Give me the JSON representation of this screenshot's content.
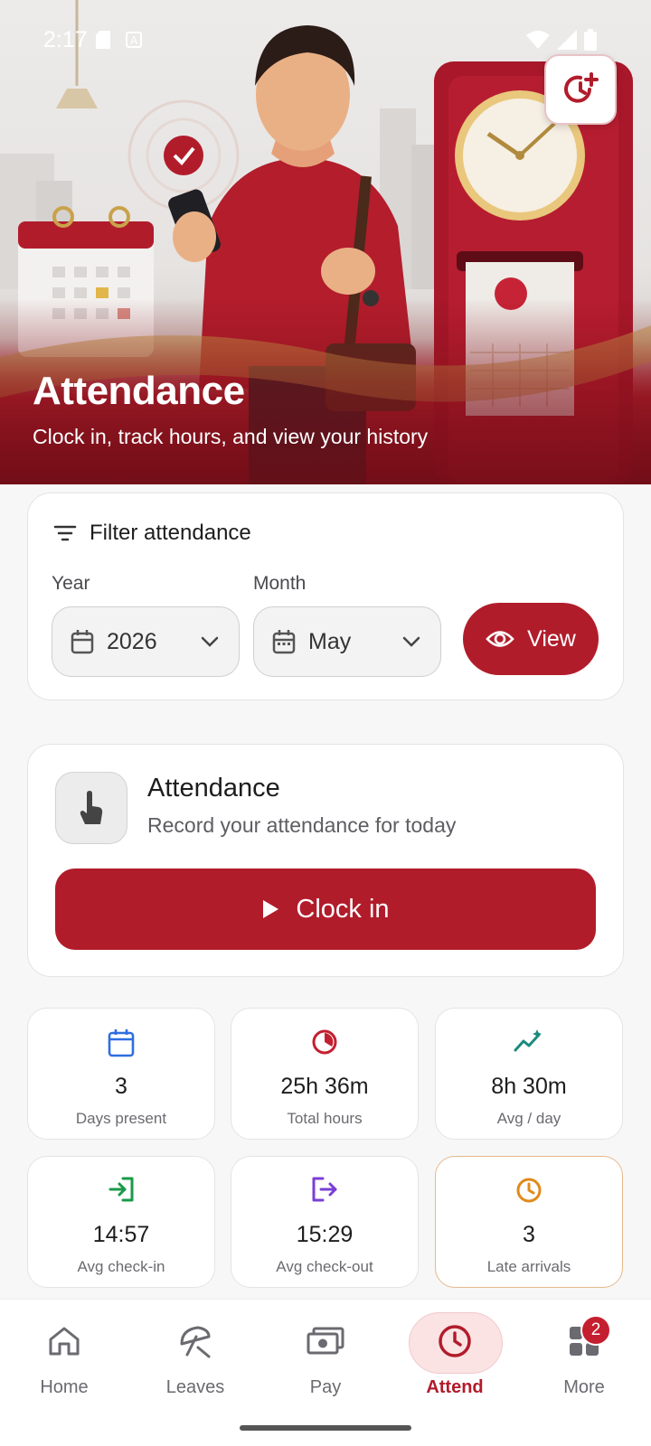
{
  "status_bar": {
    "time": "2:17"
  },
  "hero": {
    "title": "Attendance",
    "subtitle": "Clock in, track hours, and view your history"
  },
  "filter": {
    "title": "Filter attendance",
    "year_label": "Year",
    "year_value": "2026",
    "month_label": "Month",
    "month_value": "May",
    "view_label": "View"
  },
  "attendance_card": {
    "title": "Attendance",
    "subtitle": "Record your attendance for today",
    "clock_in_label": "Clock in"
  },
  "stats": [
    {
      "value": "3",
      "label": "Days present",
      "icon": "calendar-icon",
      "color": "#2f6fe0"
    },
    {
      "value": "25h 36m",
      "label": "Total hours",
      "icon": "pie-clock-icon",
      "color": "#c41f2f"
    },
    {
      "value": "8h 30m",
      "label": "Avg / day",
      "icon": "trend-sparkle-icon",
      "color": "#1a8a7e"
    },
    {
      "value": "14:57",
      "label": "Avg check-in",
      "icon": "login-icon",
      "color": "#1a9a48"
    },
    {
      "value": "15:29",
      "label": "Avg check-out",
      "icon": "logout-icon",
      "color": "#7a3fd6"
    },
    {
      "value": "3",
      "label": "Late arrivals",
      "icon": "clock-icon",
      "color": "#e08a1a"
    }
  ],
  "nav": {
    "items": [
      {
        "label": "Home",
        "icon": "home-icon"
      },
      {
        "label": "Leaves",
        "icon": "umbrella-icon"
      },
      {
        "label": "Pay",
        "icon": "money-icon"
      },
      {
        "label": "Attend",
        "icon": "clock-icon",
        "active": true
      },
      {
        "label": "More",
        "icon": "grid-icon"
      }
    ],
    "more_badge": "2"
  },
  "colors": {
    "brand": "#b11c2b",
    "active_bg": "#fbe3e4"
  }
}
